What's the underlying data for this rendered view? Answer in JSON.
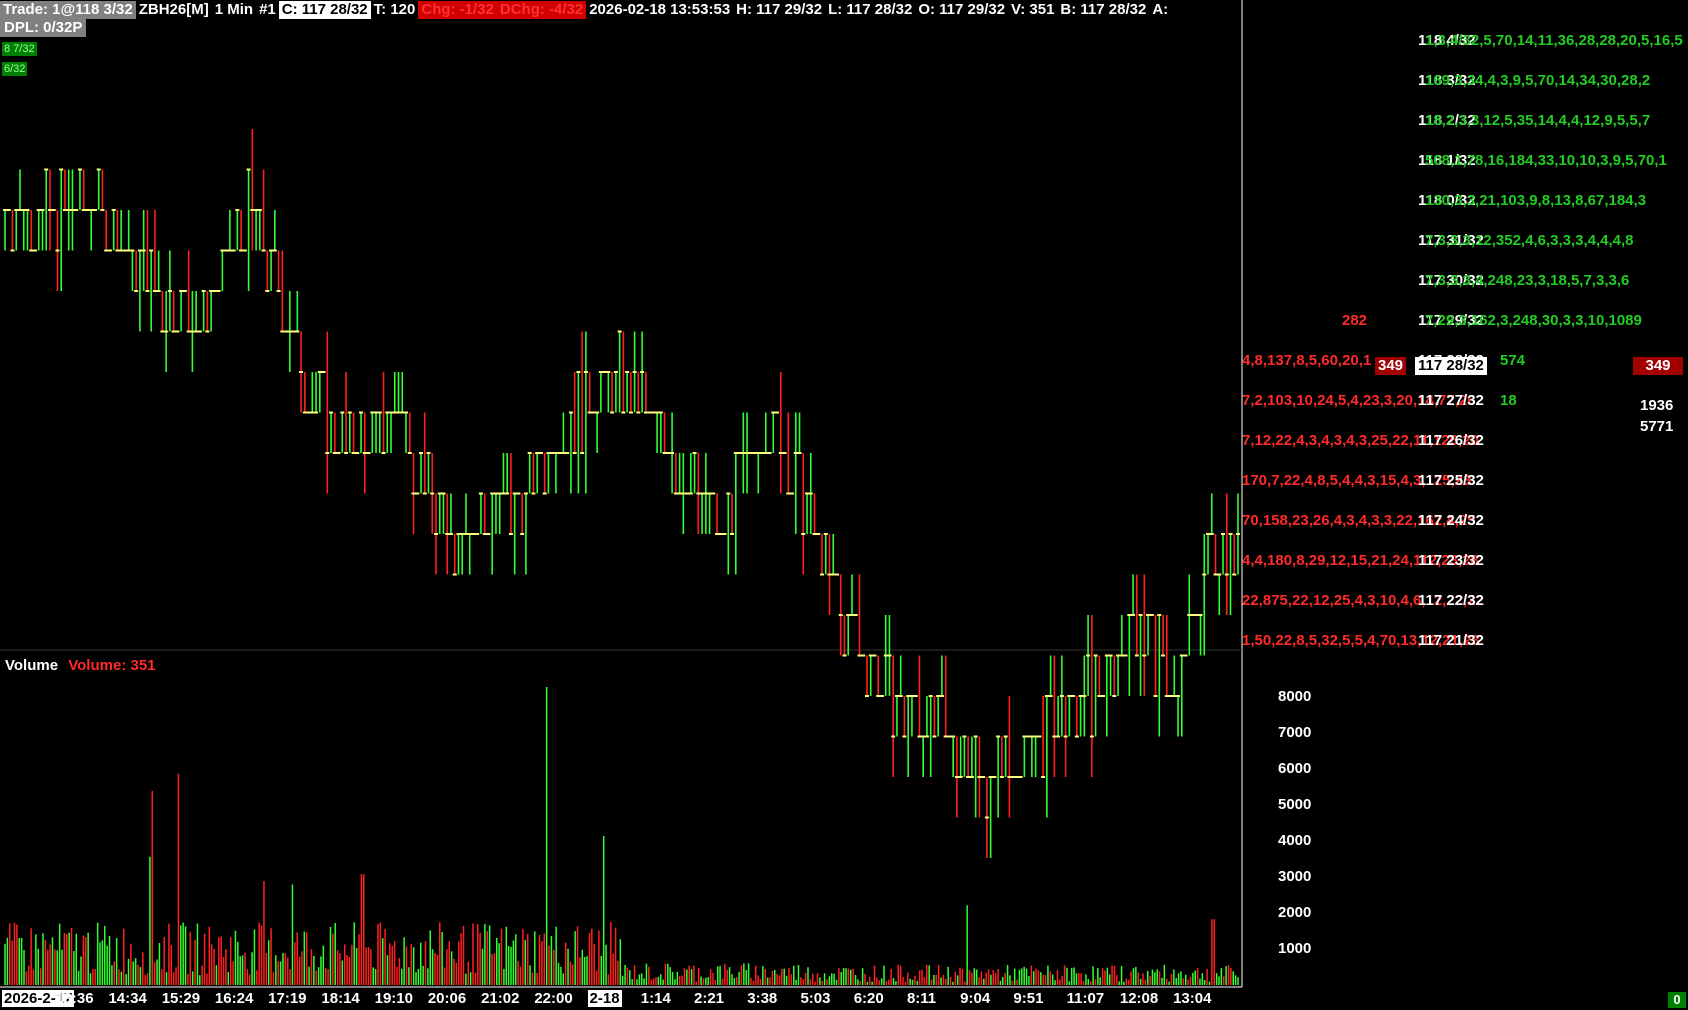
{
  "header": {
    "trade_label": "Trade: 1@118 3/32",
    "symbol": "ZBH26[M]",
    "interval": "1 Min",
    "chart_number": "#1",
    "close": "C: 117 28/32",
    "ticks": "T: 120",
    "chg": "Chg: -1/32",
    "dchg": "DChg: -4/32",
    "datetime": "2026-02-18 13:53:53",
    "high": "H: 117 29/32",
    "low": "L: 117 28/32",
    "open": "O: 117 29/32",
    "volume": "V: 351",
    "bid": "B: 117 28/32",
    "ask": "A:"
  },
  "dpl": "DPL: 0/32P",
  "fib_tags": [
    "8 7/32",
    "6/32"
  ],
  "volume_panel": {
    "title": "Volume",
    "value": "Volume: 351"
  },
  "volume_axis": [
    "8000",
    "7000",
    "6000",
    "5000",
    "4000",
    "3000",
    "2000",
    "1000"
  ],
  "time_axis": [
    "2026-2-17",
    "13:36",
    "14:34",
    "15:29",
    "16:24",
    "17:19",
    "18:14",
    "19:10",
    "20:06",
    "21:02",
    "22:00",
    "2-18",
    "1:14",
    "2:21",
    "3:38",
    "5:03",
    "6:20",
    "8:11",
    "9:04",
    "9:51",
    "11:07",
    "12:08",
    "13:04"
  ],
  "price_ladder": [
    {
      "price": "118 4/32",
      "right": "1,3,4/32,5,70,14,11,36,28,28,20,5,16,5",
      "left": ""
    },
    {
      "price": "118 3/32",
      "right": "169,3,34,4,3,9,5,70,14,34,30,28,2",
      "left": ""
    },
    {
      "price": "118 2/32",
      "right": "18,2,3,3,12,5,35,14,4,4,12,9,5,5,7",
      "left": ""
    },
    {
      "price": "118 1/32",
      "right": "508,1,78,16,184,33,10,10,3,9,5,70,1",
      "left": ""
    },
    {
      "price": "118 0/32",
      "right": "130,3,3,21,103,9,8,13,8,67,184,3",
      "left": ""
    },
    {
      "price": "117 31/32",
      "right": "7,3,3,3,12,352,4,6,3,3,3,4,4,4,8",
      "left": ""
    },
    {
      "price": "117 30/32",
      "right": "7,3,3,3,4,248,23,3,18,5,7,3,3,6",
      "left": ""
    },
    {
      "price": "117 29/32",
      "right": "7,29,3,162,3,248,30,3,3,10,1089",
      "left": "282"
    },
    {
      "price": "117 28/32",
      "right": "574",
      "left": "4,8,137,8,5,60,20,1"
    },
    {
      "price": "117 27/32",
      "right": "18",
      "left": "7,2,103,10,24,5,4,23,3,20,14,77,26"
    },
    {
      "price": "117 26/32",
      "right": "",
      "left": "7,12,22,4,3,4,3,4,3,25,22,11,126,20"
    },
    {
      "price": "117 25/32",
      "right": "",
      "left": "170,7,22,4,8,5,4,4,3,15,4,3,125,23"
    },
    {
      "price": "117 24/32",
      "right": "",
      "left": "70,158,23,26,4,3,4,3,3,22,162,4,25"
    },
    {
      "price": "117 23/32",
      "right": "",
      "left": "4,4,180,8,29,12,15,21,24,112,23,28"
    },
    {
      "price": "117 22/32",
      "right": "",
      "left": "22,875,22,12,25,4,3,10,4,6,12,22,22"
    },
    {
      "price": "117 21/32",
      "right": "",
      "left": "1,50,22,8,5,32,5,5,4,70,13,12,21,23"
    }
  ],
  "current_price": "117 28/32",
  "bid_volume_at_price": "349",
  "last_volume": "349",
  "totals": [
    "1936",
    "5771"
  ],
  "corner_value": "0",
  "colors": {
    "up": "#00ff00",
    "down": "#ff0000",
    "bar_cap": "#ffff80",
    "axis": "#ffffff",
    "bg": "#000000"
  },
  "chart_data": {
    "type": "bar",
    "title": "Trade: 1@118 3/32 ZBH26[M] 1 Min",
    "xlabel": "",
    "ylabel": "",
    "price_range": [
      "117 21/32",
      "118 4/32"
    ],
    "volume_ylim": [
      0,
      8000
    ],
    "price_path_ticks": [
      {
        "t": 0,
        "v": 4
      },
      {
        "t": 0.08,
        "v": 4
      },
      {
        "t": 0.12,
        "v": 2
      },
      {
        "t": 0.16,
        "v": 1
      },
      {
        "t": 0.2,
        "v": 4
      },
      {
        "t": 0.24,
        "v": 0
      },
      {
        "t": 0.28,
        "v": -2
      },
      {
        "t": 0.32,
        "v": -1
      },
      {
        "t": 0.36,
        "v": -4
      },
      {
        "t": 0.42,
        "v": -3
      },
      {
        "t": 0.46,
        "v": -1
      },
      {
        "t": 0.5,
        "v": 0
      },
      {
        "t": 0.54,
        "v": -2
      },
      {
        "t": 0.58,
        "v": -4
      },
      {
        "t": 0.62,
        "v": -1
      },
      {
        "t": 0.66,
        "v": -4
      },
      {
        "t": 0.68,
        "v": -6
      },
      {
        "t": 0.72,
        "v": -8
      },
      {
        "t": 0.76,
        "v": -9
      },
      {
        "t": 0.8,
        "v": -10
      },
      {
        "t": 0.84,
        "v": -9
      },
      {
        "t": 0.88,
        "v": -8
      },
      {
        "t": 0.92,
        "v": -6
      },
      {
        "t": 0.95,
        "v": -8
      },
      {
        "t": 0.98,
        "v": -4
      },
      {
        "t": 1.0,
        "v": -4
      }
    ]
  }
}
